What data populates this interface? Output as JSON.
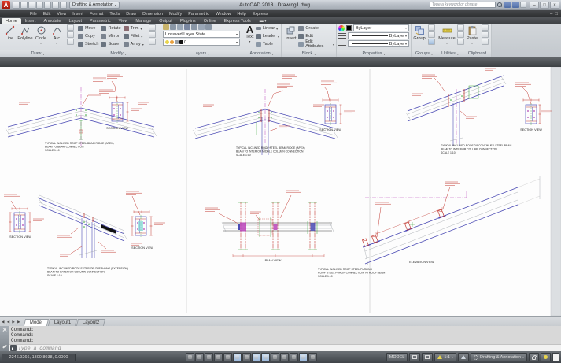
{
  "titlebar": {
    "app_title": "AutoCAD 2013",
    "doc_title": "Drawing1.dwg",
    "workspace": "Drafting & Annotation",
    "search_placeholder": "Type a keyword or phrase"
  },
  "icons": {
    "minimize": "–",
    "restore": "□",
    "close": "×",
    "dropdown": "▾",
    "nav": "◀ ◀ ▶ ▶",
    "panel_toggle": "▬ ▾"
  },
  "menubar": {
    "items": [
      "File",
      "Edit",
      "View",
      "Insert",
      "Format",
      "Tools",
      "Draw",
      "Dimension",
      "Modify",
      "Parametric",
      "Window",
      "Help",
      "Express"
    ]
  },
  "ribbon_tabs": {
    "items": [
      "Home",
      "Insert",
      "Annotate",
      "Layout",
      "Parametric",
      "View",
      "Manage",
      "Output",
      "Plug-ins",
      "Online",
      "Express Tools"
    ],
    "active": "Home"
  },
  "ribbon": {
    "draw": {
      "title": "Draw",
      "line": "Line",
      "polyline": "Polyline",
      "circle": "Circle",
      "arc": "Arc"
    },
    "modify": {
      "title": "Modify",
      "move": "Move",
      "rotate": "Rotate",
      "trim": "Trim",
      "copy": "Copy",
      "mirror": "Mirror",
      "fillet": "Fillet",
      "stretch": "Stretch",
      "scale": "Scale",
      "array": "Array"
    },
    "layers": {
      "title": "Layers",
      "state": "Unsaved Layer State",
      "layer": "0"
    },
    "annotation": {
      "title": "Annotation",
      "big_a": "A",
      "text": "Text",
      "linear": "Linear",
      "leader": "Leader",
      "table": "Table"
    },
    "block": {
      "title": "Block",
      "insert": "Insert",
      "create": "Create",
      "edit": "Edit",
      "edit_attributes": "Edit Attributes"
    },
    "properties": {
      "title": "Properties",
      "bylayer1": "ByLayer",
      "bylayer2": "ByLayer",
      "bylayer3": "ByLayer"
    },
    "groups": {
      "title": "Groups",
      "group": "Group"
    },
    "utilities": {
      "title": "Utilities",
      "measure": "Measure"
    },
    "clipboard": {
      "title": "Clipboard",
      "paste": "Paste"
    }
  },
  "drawings": {
    "d1": {
      "t1": "TYPICAL INCLINED ROOF STEEL BEAM RIDGE (APEX)",
      "t2": "BEAM TO BEAM CONNECTION",
      "t3": "SCALE 1:10",
      "view": "SECTION VIEW"
    },
    "d2": {
      "t1": "TYPICAL INCLINED ROOF STEEL BEAM RIDGE (APEX)",
      "t2": "BEAM TO INTERIOR MIDDLE COLUMN CONNECTION",
      "t3": "SCALE 1:10",
      "view": "SECTION VIEW"
    },
    "d3": {
      "t1": "TYPICAL INCLINED ROOF DISCONTINUED STEEL BEAM",
      "t2": "BEAM TO INTERIOR COLUMN CONNECTION",
      "t3": "SCALE 1:10",
      "view": "SECTION VIEW"
    },
    "d4": {
      "t1": "TYPICAL INCLINED ROOF EXTERIOR OVERHANG (EXTENSION)",
      "t2": "BEAM TO EXTERIOR COLUMN CONNECTION",
      "t3": "SCALE 1:10",
      "view": "SECTION VIEW",
      "view2": "SECTION VIEW"
    },
    "d5": {
      "t1": "TYPICAL INCLINED ROOF STEEL PURLINS",
      "t2": "ROOF STEEL PURLIN CONNECTION TO ROOF BEAM",
      "t3": "SCALE 1:10",
      "view": "PLAN VIEW"
    },
    "d6": {
      "view": "ELEVATION VIEW"
    }
  },
  "layout_tabs": {
    "model": "Model",
    "layout1": "Layout1",
    "layout2": "Layout2",
    "active": "Model"
  },
  "command": {
    "line1": "Command:",
    "line2": "Command:",
    "line3": "Command:",
    "placeholder": "Type a command"
  },
  "statusbar": {
    "coordinates": "2246.9266, 1300.8038, 0.0000",
    "model": "MODEL",
    "scale": "1:1",
    "workspace": "Drafting & Annotation"
  }
}
